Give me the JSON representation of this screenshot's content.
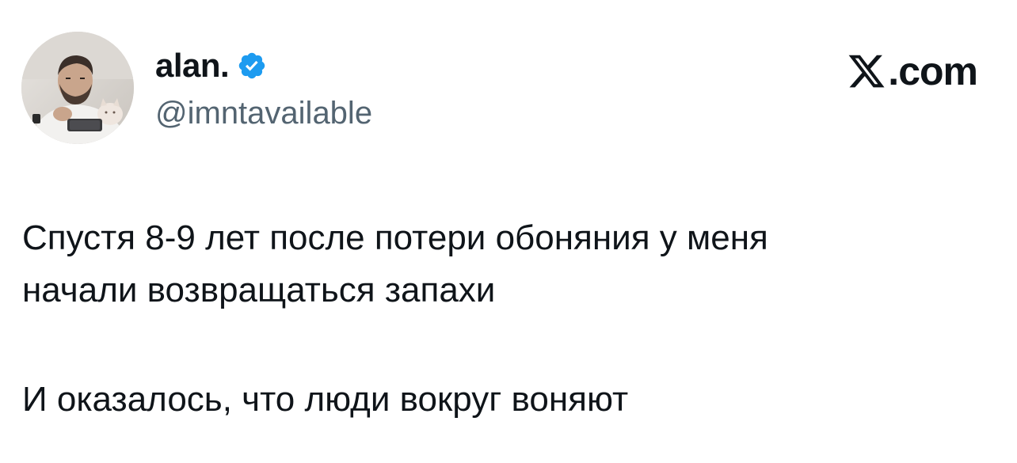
{
  "author": {
    "display_name": "alan.",
    "handle": "@imntavailable",
    "verified": true,
    "verified_badge_color": "#1d9bf0"
  },
  "brand": {
    "logo_icon": "x-logo-icon",
    "suffix": ".com"
  },
  "tweet": {
    "paragraphs": [
      {
        "lines": [
          "Спустя 8-9 лет после потери обоняния у меня",
          "начали возвращаться запахи"
        ]
      },
      {
        "lines": [
          "И оказалось, что люди вокруг воняют"
        ]
      }
    ]
  },
  "colors": {
    "text_primary": "#0f1419",
    "text_secondary": "#536471",
    "background": "#ffffff"
  }
}
